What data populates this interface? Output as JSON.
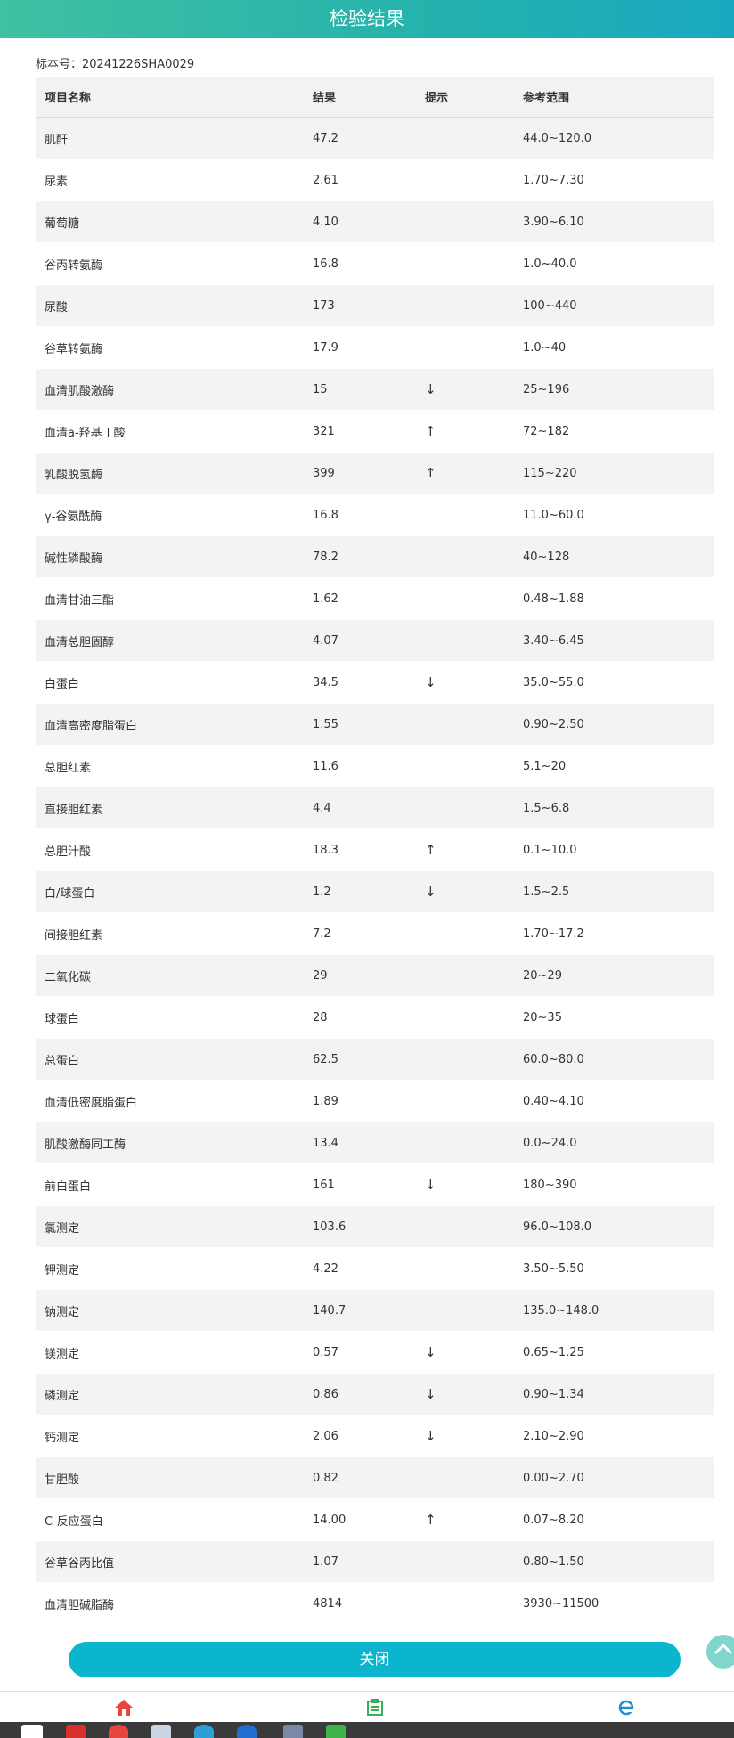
{
  "header": {
    "title": "检验结果"
  },
  "sample": {
    "label": "标本号：",
    "value": "20241226SHA0029"
  },
  "table": {
    "columns": [
      "项目名称",
      "结果",
      "提示",
      "参考范围"
    ],
    "rows": [
      {
        "name": "肌酐",
        "result": "47.2",
        "flag": "",
        "range": "44.0~120.0"
      },
      {
        "name": "尿素",
        "result": "2.61",
        "flag": "",
        "range": "1.70~7.30"
      },
      {
        "name": "葡萄糖",
        "result": "4.10",
        "flag": "",
        "range": "3.90~6.10"
      },
      {
        "name": "谷丙转氨酶",
        "result": "16.8",
        "flag": "",
        "range": "1.0~40.0"
      },
      {
        "name": "尿酸",
        "result": "173",
        "flag": "",
        "range": "100~440"
      },
      {
        "name": "谷草转氨酶",
        "result": "17.9",
        "flag": "",
        "range": "1.0~40"
      },
      {
        "name": "血清肌酸激酶",
        "result": "15",
        "flag": "↓",
        "range": "25~196"
      },
      {
        "name": "血清a-羟基丁酸",
        "result": "321",
        "flag": "↑",
        "range": "72~182"
      },
      {
        "name": "乳酸脱氢酶",
        "result": "399",
        "flag": "↑",
        "range": "115~220"
      },
      {
        "name": "γ-谷氨酰酶",
        "result": "16.8",
        "flag": "",
        "range": "11.0~60.0"
      },
      {
        "name": "碱性磷酸酶",
        "result": "78.2",
        "flag": "",
        "range": "40~128"
      },
      {
        "name": "血清甘油三酯",
        "result": "1.62",
        "flag": "",
        "range": "0.48~1.88"
      },
      {
        "name": "血清总胆固醇",
        "result": "4.07",
        "flag": "",
        "range": "3.40~6.45"
      },
      {
        "name": "白蛋白",
        "result": "34.5",
        "flag": "↓",
        "range": "35.0~55.0"
      },
      {
        "name": "血清高密度脂蛋白",
        "result": "1.55",
        "flag": "",
        "range": "0.90~2.50"
      },
      {
        "name": "总胆红素",
        "result": "11.6",
        "flag": "",
        "range": "5.1~20"
      },
      {
        "name": "直接胆红素",
        "result": "4.4",
        "flag": "",
        "range": "1.5~6.8"
      },
      {
        "name": "总胆汁酸",
        "result": "18.3",
        "flag": "↑",
        "range": "0.1~10.0"
      },
      {
        "name": "白/球蛋白",
        "result": "1.2",
        "flag": "↓",
        "range": "1.5~2.5"
      },
      {
        "name": "间接胆红素",
        "result": "7.2",
        "flag": "",
        "range": "1.70~17.2"
      },
      {
        "name": "二氧化碳",
        "result": "29",
        "flag": "",
        "range": "20~29"
      },
      {
        "name": "球蛋白",
        "result": "28",
        "flag": "",
        "range": "20~35"
      },
      {
        "name": "总蛋白",
        "result": "62.5",
        "flag": "",
        "range": "60.0~80.0"
      },
      {
        "name": "血清低密度脂蛋白",
        "result": "1.89",
        "flag": "",
        "range": "0.40~4.10"
      },
      {
        "name": "肌酸激酶同工酶",
        "result": "13.4",
        "flag": "",
        "range": "0.0~24.0"
      },
      {
        "name": "前白蛋白",
        "result": "161",
        "flag": "↓",
        "range": "180~390"
      },
      {
        "name": "氯测定",
        "result": "103.6",
        "flag": "",
        "range": "96.0~108.0"
      },
      {
        "name": "钾测定",
        "result": "4.22",
        "flag": "",
        "range": "3.50~5.50"
      },
      {
        "name": "钠测定",
        "result": "140.7",
        "flag": "",
        "range": "135.0~148.0"
      },
      {
        "name": "镁测定",
        "result": "0.57",
        "flag": "↓",
        "range": "0.65~1.25"
      },
      {
        "name": "磷测定",
        "result": "0.86",
        "flag": "↓",
        "range": "0.90~1.34"
      },
      {
        "name": "钙测定",
        "result": "2.06",
        "flag": "↓",
        "range": "2.10~2.90"
      },
      {
        "name": "甘胆酸",
        "result": "0.82",
        "flag": "",
        "range": "0.00~2.70"
      },
      {
        "name": "C-反应蛋白",
        "result": "14.00",
        "flag": "↑",
        "range": "0.07~8.20"
      },
      {
        "name": "谷草谷丙比值",
        "result": "1.07",
        "flag": "",
        "range": "0.80~1.50"
      },
      {
        "name": "血清胆碱脂酶",
        "result": "4814",
        "flag": "",
        "range": "3930~11500"
      }
    ]
  },
  "close_button": {
    "label": "关闭"
  },
  "colors": {
    "header_start": "#3fc1a2",
    "header_end": "#1aa9c0",
    "button": "#0ab5cd",
    "home_icon": "#e8453c",
    "report_icon": "#3aae5c",
    "browser_icon": "#1a8fd6"
  },
  "icons": {
    "nav": [
      "home-icon",
      "report-icon",
      "browser-icon"
    ],
    "scroll": "arrow-up-icon"
  }
}
